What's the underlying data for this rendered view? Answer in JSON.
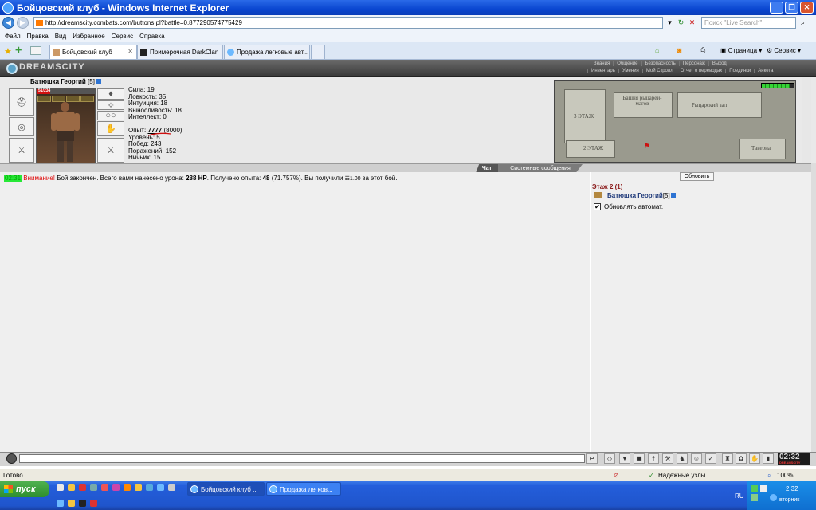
{
  "window": {
    "title": "Бойцовский клуб - Windows Internet Explorer"
  },
  "address": {
    "url": "http://dreamscity.combats.com/buttons.pl?battle=0.877290574775429"
  },
  "search": {
    "placeholder": "Поиск \"Live Search\""
  },
  "menu": [
    "Файл",
    "Правка",
    "Вид",
    "Избранное",
    "Сервис",
    "Справка"
  ],
  "tabs": [
    {
      "label": "Бойцовский клуб",
      "active": true
    },
    {
      "label": "Примерочная DarkClan"
    },
    {
      "label": "Продажа легковые авт..."
    }
  ],
  "command_bar": {
    "page": "Страница",
    "tools": "Сервис"
  },
  "game": {
    "logo": "DREAMSCITY",
    "menu_top": [
      "Знания",
      "Общение",
      "Безопасность",
      "Персонаж",
      "Выход"
    ],
    "menu_bottom": [
      "Инвентарь",
      "Умения",
      "Мой Скролл",
      "Отчет о переводах",
      "Поединки",
      "Анкета"
    ]
  },
  "character": {
    "name": "Батюшка Георгий",
    "level": "[5]",
    "hp_text": "51/234",
    "hp_fraction": 0.218,
    "stats": [
      "Сила: 19",
      "Ловкость: 35",
      "Интуиция: 18",
      "Выносливость: 18",
      "Интеллект: 0"
    ],
    "exp_label": "Опыт:",
    "exp_value": "7777",
    "exp_next": "(8000)",
    "summary": [
      "Уровень: 5",
      "Побед: 243",
      "Поражений: 152",
      "Ничьих: 15"
    ]
  },
  "map": {
    "labels": [
      "3 ЭТАЖ",
      "Башня рыцарей-магов",
      "Рыцарский зал",
      "2 ЭТАЖ",
      "Таверна"
    ],
    "meter_fraction": 0.85
  },
  "chat": {
    "tab_chat": "Чат",
    "tab_system": "Системные сообщения",
    "message": {
      "time": "02:31",
      "warning": "Внимание!",
      "text1": " Бой закончен. Всего вами нанесено урона: ",
      "damage": "288 HP",
      "text2": ". Получено опыта: ",
      "exp": "48",
      "text3": " (71.757%). Вы получили ",
      "money": "☶1.00",
      "text4": " за этот бой."
    }
  },
  "room": {
    "refresh_label": "Обновить",
    "floor_title": "Этаж 2 (1)",
    "player_name": "Батюшка Георгий",
    "player_level": "[5]",
    "auto_refresh_label": "Обновлять автомат."
  },
  "clock": {
    "time": "02:32",
    "sub": "DREAMSCITY"
  },
  "status": {
    "left": "Готово",
    "zone": "Надежные узлы",
    "zoom": "100%"
  },
  "taskbar": {
    "start": "пуск",
    "buttons": [
      "Бойцовский клуб ...",
      "Продажа легков..."
    ],
    "tray_lang": "RU",
    "tray_time": "2:32",
    "tray_day": "вторник"
  }
}
